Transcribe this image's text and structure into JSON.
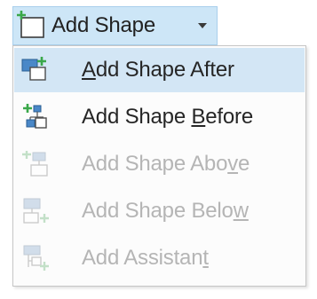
{
  "split_button": {
    "label": "Add Shape",
    "icon": "add-shape-icon",
    "dropdown_icon": "chevron-down-icon"
  },
  "menu": {
    "items": [
      {
        "label": "Add Shape After",
        "access_key": "A",
        "enabled": true,
        "selected": true,
        "icon": "add-shape-after-icon"
      },
      {
        "label": "Add Shape Before",
        "access_key": "B",
        "enabled": true,
        "selected": false,
        "icon": "add-shape-before-icon"
      },
      {
        "label": "Add Shape Above",
        "access_key": "v",
        "enabled": false,
        "selected": false,
        "icon": "add-shape-above-icon"
      },
      {
        "label": "Add Shape Below",
        "access_key": "w",
        "enabled": false,
        "selected": false,
        "icon": "add-shape-below-icon"
      },
      {
        "label": "Add Assistant",
        "access_key": "t",
        "enabled": false,
        "selected": false,
        "icon": "add-assistant-icon"
      }
    ]
  },
  "colors": {
    "highlight": "#d3e6f5",
    "button_bg": "#cde6f7",
    "accent_green": "#3aa84a",
    "accent_blue": "#2e7bc4",
    "disabled_text": "#b5b5b5"
  }
}
